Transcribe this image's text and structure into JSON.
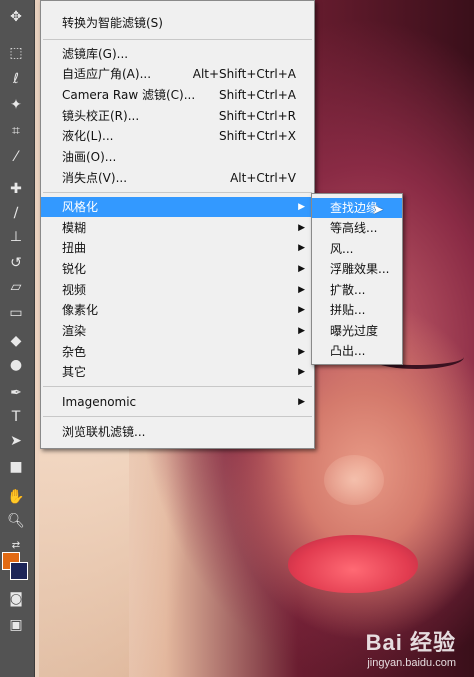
{
  "main_menu": {
    "items": [
      {
        "label": "转换为智能滤镜(S)",
        "shortcut": ""
      },
      {
        "label": "滤镜库(G)...",
        "shortcut": ""
      },
      {
        "label": "自适应广角(A)...",
        "shortcut": "Alt+Shift+Ctrl+A"
      },
      {
        "label": "Camera Raw 滤镜(C)...",
        "shortcut": "Shift+Ctrl+A"
      },
      {
        "label": "镜头校正(R)...",
        "shortcut": "Shift+Ctrl+R"
      },
      {
        "label": "液化(L)...",
        "shortcut": "Shift+Ctrl+X"
      },
      {
        "label": "油画(O)...",
        "shortcut": ""
      },
      {
        "label": "消失点(V)...",
        "shortcut": "Alt+Ctrl+V"
      },
      {
        "label": "风格化",
        "shortcut": ""
      },
      {
        "label": "模糊",
        "shortcut": ""
      },
      {
        "label": "扭曲",
        "shortcut": ""
      },
      {
        "label": "锐化",
        "shortcut": ""
      },
      {
        "label": "视频",
        "shortcut": ""
      },
      {
        "label": "像素化",
        "shortcut": ""
      },
      {
        "label": "渲染",
        "shortcut": ""
      },
      {
        "label": "杂色",
        "shortcut": ""
      },
      {
        "label": "其它",
        "shortcut": ""
      },
      {
        "label": "Imagenomic",
        "shortcut": ""
      },
      {
        "label": "浏览联机滤镜...",
        "shortcut": ""
      }
    ],
    "selected": "风格化"
  },
  "sub_menu": {
    "items": [
      "查找边缘",
      "等高线...",
      "风...",
      "浮雕效果...",
      "扩散...",
      "拼贴...",
      "曝光过度",
      "凸出..."
    ],
    "selected": "查找边缘"
  },
  "toolbar": {
    "tools": [
      "move-tool",
      "marquee-tool",
      "lasso-tool",
      "magic-wand-tool",
      "crop-tool",
      "eyedropper-tool",
      "healing-brush-tool",
      "brush-tool",
      "clone-stamp-tool",
      "history-brush-tool",
      "eraser-tool",
      "gradient-tool",
      "blur-tool",
      "dodge-tool",
      "pen-tool",
      "type-tool",
      "path-selection-tool",
      "rectangle-tool",
      "hand-tool",
      "zoom-tool"
    ],
    "foreground_color": "#e26a14",
    "background_color": "#1c2558"
  },
  "watermark": {
    "logo": "Bai 经验",
    "url": "jingyan.baidu.com"
  }
}
